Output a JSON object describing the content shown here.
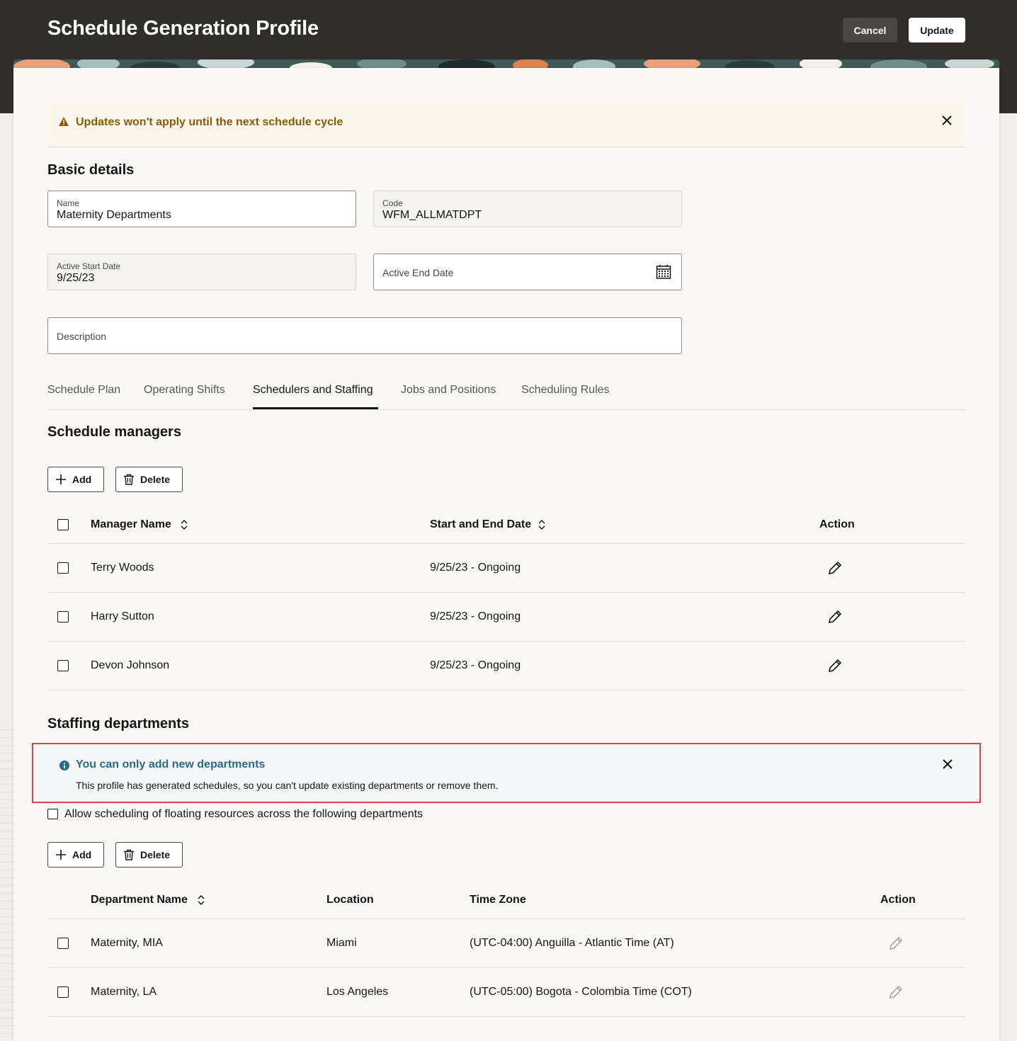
{
  "header": {
    "title": "Schedule Generation Profile",
    "cancel_label": "Cancel",
    "update_label": "Update"
  },
  "warning": {
    "text": "Updates won't apply until the next schedule cycle"
  },
  "basic": {
    "heading": "Basic details",
    "name_label": "Name",
    "name_value": "Maternity Departments",
    "code_label": "Code",
    "code_value": "WFM_ALLMATDPT",
    "start_label": "Active Start Date",
    "start_value": "9/25/23",
    "end_label": "Active End Date",
    "description_label": "Description"
  },
  "tabs": [
    {
      "label": "Schedule Plan"
    },
    {
      "label": "Operating Shifts"
    },
    {
      "label": "Schedulers and Staffing",
      "active": true
    },
    {
      "label": "Jobs and Positions"
    },
    {
      "label": "Scheduling Rules"
    }
  ],
  "managers": {
    "heading": "Schedule managers",
    "add_label": "Add",
    "delete_label": "Delete",
    "columns": [
      "Manager Name",
      "Start and End Date",
      "Action"
    ],
    "rows": [
      {
        "name": "Terry Woods",
        "dates": "9/25/23 - Ongoing"
      },
      {
        "name": "Harry Sutton",
        "dates": "9/25/23 - Ongoing"
      },
      {
        "name": "Devon Johnson",
        "dates": "9/25/23 - Ongoing"
      }
    ]
  },
  "departments": {
    "heading": "Staffing departments",
    "info_title": "You can only add new departments",
    "info_body": "This profile has generated schedules, so you can't update existing departments or remove them.",
    "floating_label": "Allow scheduling of floating resources across the following departments",
    "add_label": "Add",
    "delete_label": "Delete",
    "columns": [
      "Department Name",
      "Location",
      "Time Zone",
      "Action"
    ],
    "rows": [
      {
        "name": "Maternity, MIA",
        "location": "Miami",
        "timezone": "(UTC-04:00) Anguilla - Atlantic Time (AT)"
      },
      {
        "name": "Maternity, LA",
        "location": "Los Angeles",
        "timezone": "(UTC-05:00) Bogota - Colombia Time (COT)"
      }
    ]
  },
  "colors": {
    "header_bg": "#312d2a",
    "warning_text": "#8a5a0a",
    "info_text": "#2b6a83",
    "highlight_border": "#d9444a"
  }
}
